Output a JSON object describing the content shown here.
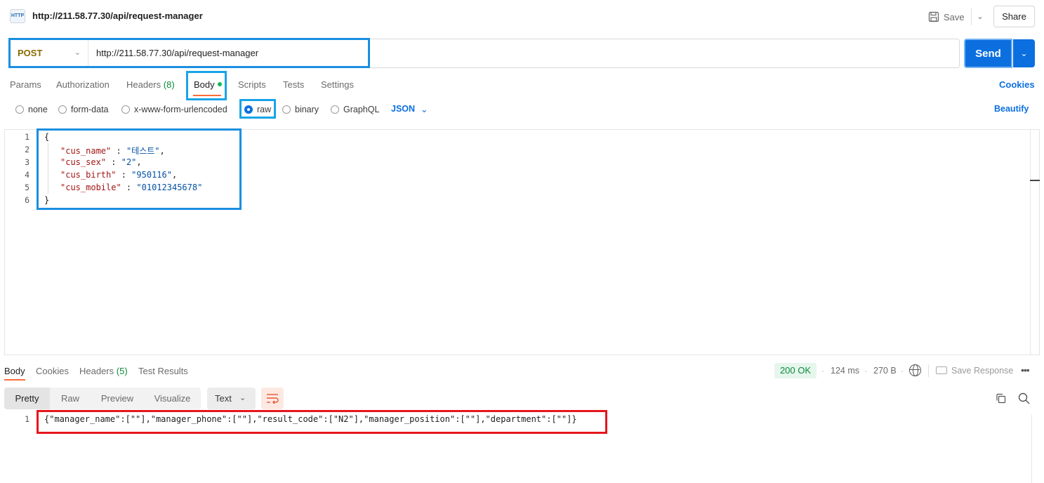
{
  "header": {
    "icon_label": "HTTP",
    "title": "http://211.58.77.30/api/request-manager",
    "save_label": "Save",
    "share_label": "Share"
  },
  "request": {
    "method": "POST",
    "url": "http://211.58.77.30/api/request-manager",
    "send_label": "Send"
  },
  "tabs": {
    "params": "Params",
    "authorization": "Authorization",
    "headers": "Headers",
    "headers_count": "(8)",
    "body": "Body",
    "scripts": "Scripts",
    "tests": "Tests",
    "settings": "Settings",
    "cookies": "Cookies"
  },
  "body_types": {
    "none": "none",
    "form_data": "form-data",
    "urlencoded": "x-www-form-urlencoded",
    "raw": "raw",
    "binary": "binary",
    "graphql": "GraphQL",
    "format": "JSON",
    "beautify": "Beautify",
    "selected": "raw"
  },
  "editor": {
    "line_numbers": [
      "1",
      "2",
      "3",
      "4",
      "5",
      "6"
    ],
    "open_brace": "{",
    "close_brace": "}",
    "fields": [
      {
        "key": "\"cus_name\"",
        "value": "\"테스트\"",
        "trailing": ","
      },
      {
        "key": "\"cus_sex\"",
        "value": "\"2\"",
        "trailing": ","
      },
      {
        "key": "\"cus_birth\"",
        "value": "\"950116\"",
        "trailing": ","
      },
      {
        "key": "\"cus_mobile\"",
        "value": "\"01012345678\"",
        "trailing": ""
      }
    ]
  },
  "response": {
    "tabs": {
      "body": "Body",
      "cookies": "Cookies",
      "headers": "Headers",
      "headers_count": "(5)",
      "test_results": "Test Results"
    },
    "status": "200 OK",
    "time": "124 ms",
    "size": "270 B",
    "save_response": "Save Response",
    "views": {
      "pretty": "Pretty",
      "raw": "Raw",
      "preview": "Preview",
      "visualize": "Visualize"
    },
    "format": "Text",
    "line_number": "1",
    "body": "{\"manager_name\":[\"\"],\"manager_phone\":[\"\"],\"result_code\":[\"N2\"],\"manager_position\":[\"\"],\"department\":[\"\"]}"
  },
  "colors": {
    "send": "#0c6fe0",
    "accent_underline": "#ff6c37",
    "highlight_blue": "#1a8fe0",
    "highlight_red": "#e5171d",
    "status_ok": "#0a8a3a"
  }
}
